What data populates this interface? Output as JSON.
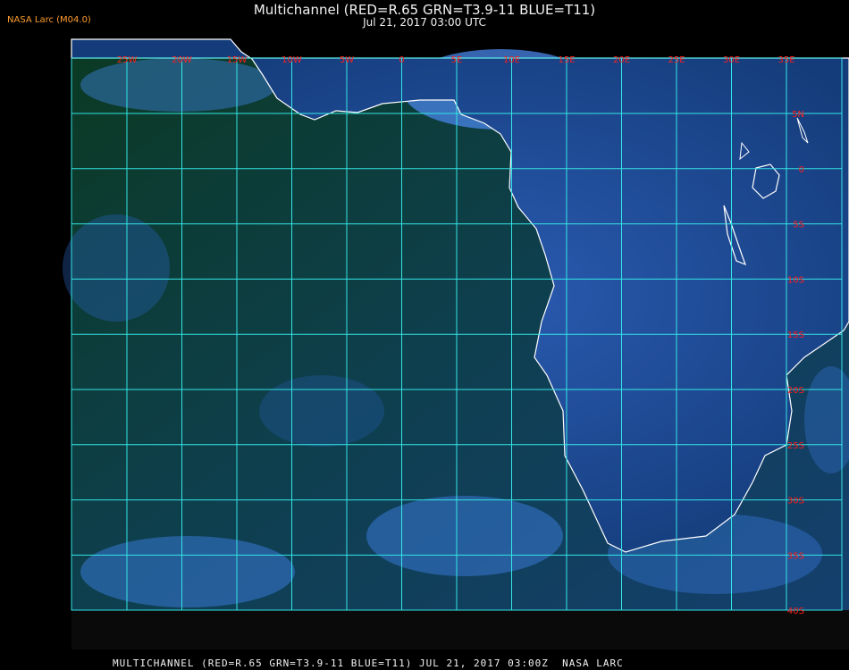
{
  "header": {
    "title": "Multichannel (RED=R.65 GRN=T3.9-11 BLUE=T11)",
    "datetime": "Jul 21, 2017 03:00 UTC",
    "version": "NASA Larc (M04.0)"
  },
  "footer": {
    "caption": "MULTICHANNEL (RED=R.65 GRN=T3.9-11 BLUE=T11) JUL 21, 2017 03:00Z  NASA LARC"
  },
  "map": {
    "longitude_labels": [
      "25W",
      "20W",
      "15W",
      "10W",
      "5W",
      "0",
      "5E",
      "10E",
      "15E",
      "20E",
      "25E",
      "30E",
      "35E"
    ],
    "latitude_labels": [
      "5N",
      "0",
      "5S",
      "10S",
      "15S",
      "20S",
      "25S",
      "30S",
      "35S",
      "40S"
    ],
    "colors": {
      "grid": "#33e6e6",
      "coast": "#ffffff",
      "label": "#ff1e1e",
      "ocean": "#0e4a6a",
      "land_dark": "#0a3a1c",
      "cloud": "#3e88ff"
    }
  }
}
